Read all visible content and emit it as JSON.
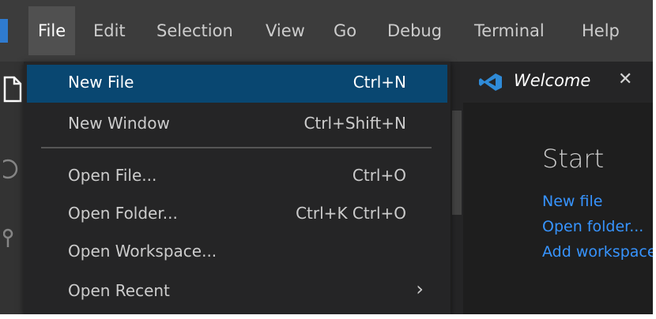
{
  "menubar": {
    "items": [
      {
        "label": "File",
        "active": true
      },
      {
        "label": "Edit"
      },
      {
        "label": "Selection"
      },
      {
        "label": "View"
      },
      {
        "label": "Go"
      },
      {
        "label": "Debug"
      },
      {
        "label": "Terminal"
      },
      {
        "label": "Help"
      }
    ]
  },
  "file_menu": {
    "items": [
      {
        "label": "New File",
        "shortcut": "Ctrl+N",
        "highlighted": true
      },
      {
        "label": "New Window",
        "shortcut": "Ctrl+Shift+N"
      },
      {
        "label": "Open File...",
        "shortcut": "Ctrl+O"
      },
      {
        "label": "Open Folder...",
        "shortcut": "Ctrl+K Ctrl+O"
      },
      {
        "label": "Open Workspace...",
        "shortcut": ""
      },
      {
        "label": "Open Recent",
        "submenu": true
      }
    ]
  },
  "editor": {
    "tab": {
      "title": "Welcome",
      "icon": "vscode-logo-icon",
      "close": "✕"
    },
    "start": {
      "heading": "Start",
      "links": [
        "New file",
        "Open folder...",
        "Add workspace folder..."
      ]
    }
  },
  "colors": {
    "menubar_bg": "#3c3c3c",
    "menu_bg": "#252526",
    "highlight": "#094771",
    "link": "#3794ff",
    "brand_blue": "#2f7bd0"
  }
}
